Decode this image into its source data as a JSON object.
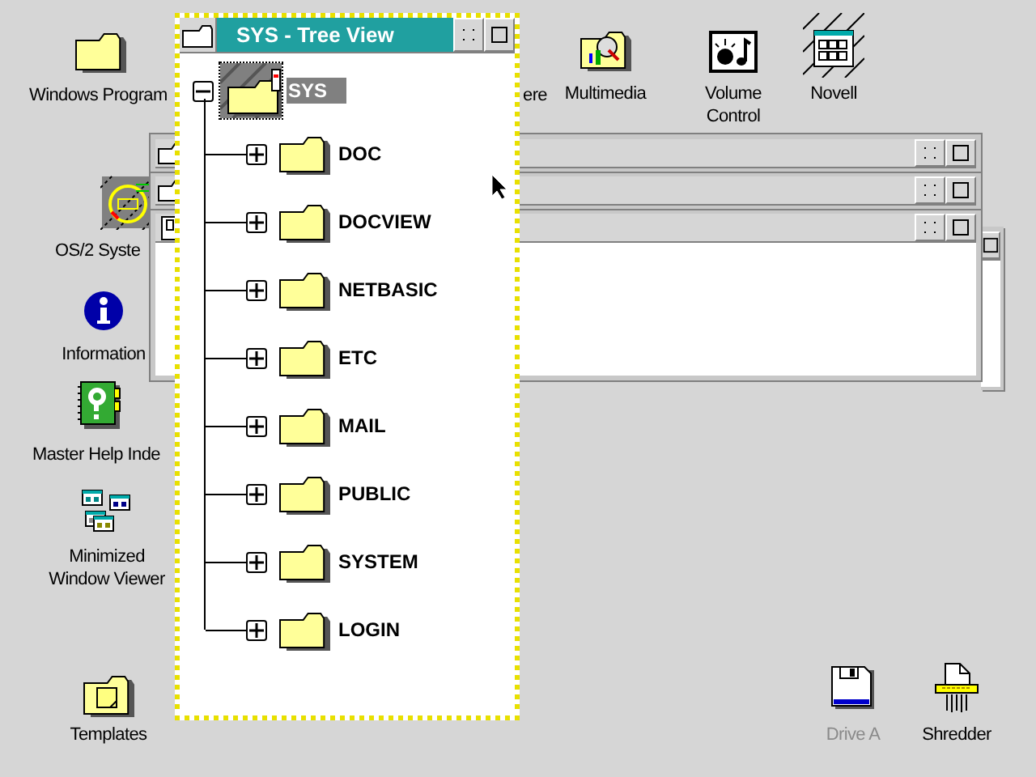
{
  "desktop": {
    "icons": [
      {
        "kind": "folder",
        "label": "Windows Program",
        "dimmed": false
      },
      {
        "kind": "os2-system",
        "label": "OS/2 Syste",
        "dimmed": false
      },
      {
        "kind": "info",
        "label": "Information",
        "dimmed": false
      },
      {
        "kind": "help-book",
        "label": "Master Help Inde",
        "dimmed": false
      },
      {
        "kind": "minimized-viewer",
        "label": "Minimized Window Viewer",
        "dimmed": false
      },
      {
        "kind": "templates",
        "label": "Templates",
        "dimmed": false
      },
      {
        "kind": "hidden",
        "label": "ere",
        "dimmed": false
      },
      {
        "kind": "multimedia",
        "label": "Multimedia",
        "dimmed": false
      },
      {
        "kind": "volume",
        "label": "Volume Control",
        "dimmed": false
      },
      {
        "kind": "novell",
        "label": "Novell",
        "dimmed": false
      },
      {
        "kind": "drive",
        "label": "Drive A",
        "dimmed": true
      },
      {
        "kind": "shredder",
        "label": "Shredder",
        "dimmed": false
      }
    ]
  },
  "background_windows": [
    {
      "kind": "folder"
    },
    {
      "kind": "folder"
    },
    {
      "kind": "drive"
    },
    {
      "kind": "plain"
    }
  ],
  "tree_window": {
    "title": "SYS - Tree View",
    "active": true,
    "root": {
      "label": "SYS",
      "expanded": true,
      "selected": true,
      "children": [
        {
          "label": "DOC",
          "expanded": false
        },
        {
          "label": "DOCVIEW",
          "expanded": false
        },
        {
          "label": "NETBASIC",
          "expanded": false
        },
        {
          "label": "ETC",
          "expanded": false
        },
        {
          "label": "MAIL",
          "expanded": false
        },
        {
          "label": "PUBLIC",
          "expanded": false
        },
        {
          "label": "SYSTEM",
          "expanded": false
        },
        {
          "label": "LOGIN",
          "expanded": false
        }
      ]
    }
  }
}
